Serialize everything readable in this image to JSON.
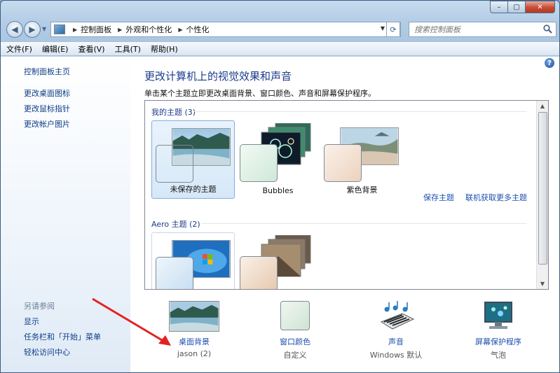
{
  "window": {
    "caption": {
      "minimize": "–",
      "maximize": "▢",
      "close": "✕"
    }
  },
  "address": {
    "crumbs": [
      "控制面板",
      "外观和个性化",
      "个性化"
    ],
    "search_placeholder": "搜索控制面板"
  },
  "menu": {
    "items": [
      "文件(F)",
      "编辑(E)",
      "查看(V)",
      "工具(T)",
      "帮助(H)"
    ]
  },
  "sidebar": {
    "home": "控制面板主页",
    "links": [
      "更改桌面图标",
      "更改鼠标指针",
      "更改帐户图片"
    ],
    "see_also_title": "另请参阅",
    "see_also": [
      "显示",
      "任务栏和「开始」菜单",
      "轻松访问中心"
    ]
  },
  "main": {
    "help_icon": "?",
    "title": "更改计算机上的视觉效果和声音",
    "description": "单击某个主题立即更改桌面背景、窗口颜色、声音和屏幕保护程序。",
    "my_themes_header": "我的主题 (3)",
    "my_themes": [
      {
        "label": "未保存的主题",
        "selected": true,
        "swatch_color": "#dfeadf"
      },
      {
        "label": "Bubbles",
        "selected": false,
        "swatch_color": "#dff0e6"
      },
      {
        "label": "紫色背景",
        "selected": false,
        "swatch_color": "#f0dccc"
      }
    ],
    "save_theme_link": "保存主题",
    "online_themes_link": "联机获取更多主题",
    "aero_header": "Aero 主题 (2)",
    "bottom": {
      "desktop_background": {
        "caption": "桌面背景",
        "sub": "jason (2)"
      },
      "window_color": {
        "caption": "窗口颜色",
        "sub": "自定义"
      },
      "sounds": {
        "caption": "声音",
        "sub": "Windows 默认"
      },
      "screensaver": {
        "caption": "屏幕保护程序",
        "sub": "气泡"
      }
    }
  },
  "colors": {
    "link": "#1d4fb0",
    "title": "#1b3b8c",
    "sidebar_link": "#0d3c85"
  }
}
